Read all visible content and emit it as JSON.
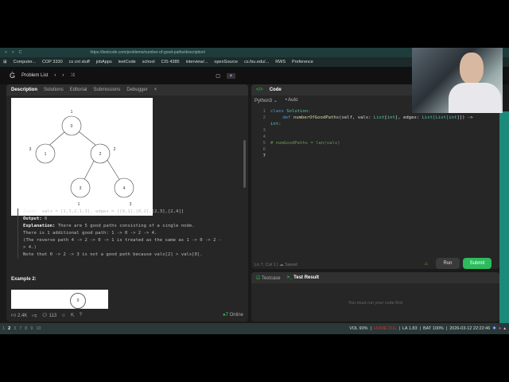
{
  "browser": {
    "url": "https://leetcode.com/problems/number-of-good-paths/description/",
    "bookmarks": [
      "Computer...",
      "COP 3330",
      "cs cnt stuff",
      "jobApps",
      "leetCode",
      "school",
      "CIS 4385",
      "interview/...",
      "openSource",
      "cs.fsu.edu/...",
      "RWS",
      "Preference"
    ]
  },
  "header": {
    "problem_list": "Problem List"
  },
  "left_tabs": [
    "Description",
    "Solutions",
    "Editorial",
    "Submissions",
    "Debugger"
  ],
  "graph": {
    "nodes": [
      "0",
      "1",
      "2",
      "3",
      "4"
    ],
    "vals": [
      "1",
      "3",
      "2",
      "1",
      "3"
    ]
  },
  "example1": {
    "input_label": "Input:",
    "input": "vals = [1,3,2,1,3], edges = [[0,1],[0,2],[2,3],[2,4]]",
    "output_label": "Output:",
    "output": "6",
    "explanation_label": "Explanation:",
    "lines": [
      "There are 5 good paths consisting of a single node.",
      "There is 1 additional good path: 1 -> 0 -> 2 -> 4.",
      "(The reverse path 4 -> 2 -> 0 -> 1 is treated as the same as 1 -> 0 -> 2 -",
      "> 4.)",
      "Note that 0 -> 2 -> 3 is not a good path because vals[2] > vals[0]."
    ]
  },
  "example2": {
    "title": "Example 2:",
    "node": "0"
  },
  "footer": {
    "likes": "2.4K",
    "comments": "113",
    "online": "7 Online"
  },
  "code_panel": {
    "title": "Code",
    "language": "Python3",
    "mode": "Auto",
    "cursor": "Ln 7, Col 1",
    "saved": "Saved",
    "run": "Run",
    "submit": "Submit"
  },
  "code": {
    "l1a": "class",
    "l1b": "Solution:",
    "l2a": "def",
    "l2b": "numberOfGoodPaths",
    "l2c": "(self, vals: ",
    "l2d": "List",
    "l2e": "[",
    "l2f": "int",
    "l2g": "], edges: ",
    "l2h": "List[List[",
    "l2i": "int",
    "l2j": "]]) ->",
    "l3": "int:",
    "l5": "# numGoodPaths = len(vals)",
    "nums": [
      "1",
      "2",
      "",
      "3",
      "4",
      "5",
      "6",
      "7"
    ]
  },
  "result_panel": {
    "tabs": [
      "Testcase",
      "Test Result"
    ],
    "empty": "You must run your code first"
  },
  "statusbar": {
    "workspaces": [
      "1",
      "2",
      "3",
      "7",
      "8",
      "9",
      "10"
    ],
    "vol": "VOL 90%",
    "home": "HOME 21G",
    "la": "LA 1.83",
    "bat": "BAT 100%",
    "datetime": "2026-03-12 22:22:46"
  }
}
